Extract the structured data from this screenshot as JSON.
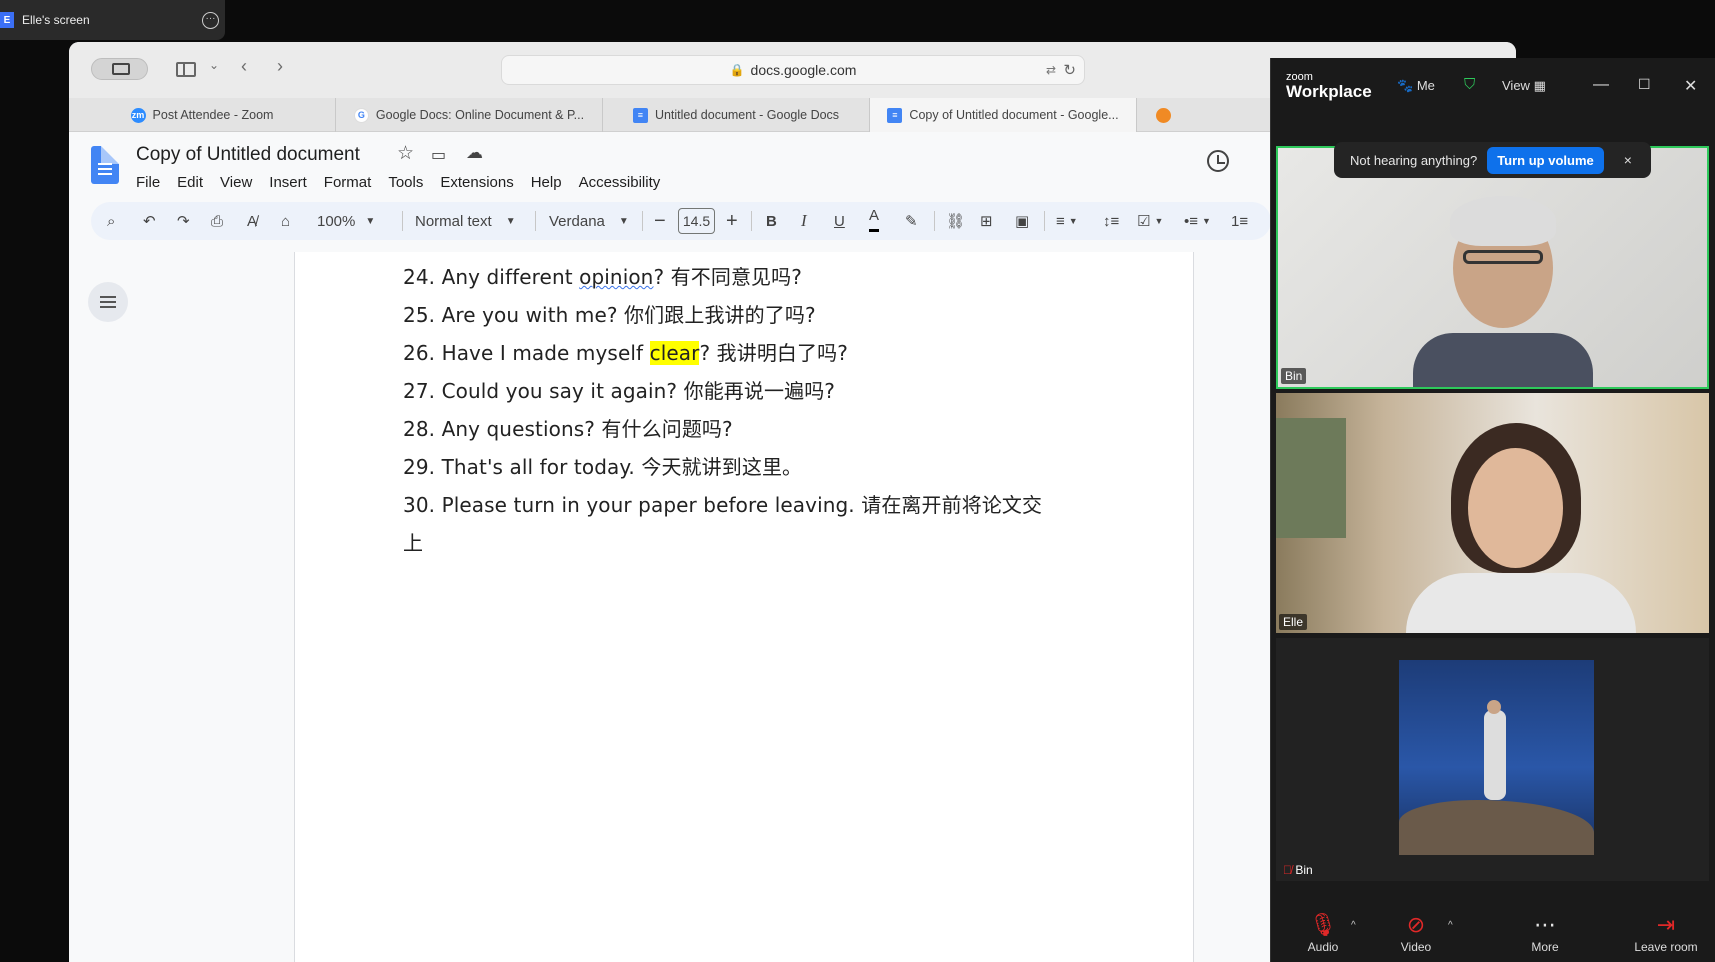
{
  "share_bar": {
    "badge": "E",
    "label": "Elle's screen",
    "more_icon": "more-options-icon"
  },
  "browser": {
    "address": "docs.google.com",
    "tabs": [
      {
        "label": "Post Attendee - Zoom",
        "icon": "zoom-icon"
      },
      {
        "label": "Google Docs: Online Document & P...",
        "icon": "google-icon"
      },
      {
        "label": "Untitled document - Google Docs",
        "icon": "docs-icon"
      },
      {
        "label": "Copy of Untitled document - Google...",
        "icon": "docs-icon",
        "active": true
      }
    ]
  },
  "docs": {
    "title": "Copy of Untitled document",
    "menu": [
      "File",
      "Edit",
      "View",
      "Insert",
      "Format",
      "Tools",
      "Extensions",
      "Help",
      "Accessibility"
    ],
    "toolbar": {
      "zoom": "100%",
      "style": "Normal text",
      "font": "Verdana",
      "font_size": "14.5"
    },
    "lines": [
      {
        "pre": "24. Any different ",
        "squiggle": "opinion",
        "post": "? 有不同意见吗?"
      },
      {
        "pre": "25. Are you with me? 你们跟上我讲的了吗?"
      },
      {
        "pre": "26. Have I made myself ",
        "highlight": "clear",
        "post": "? 我讲明白了吗?"
      },
      {
        "pre": "27. Could you say it again? 你能再说一遍吗?"
      },
      {
        "pre": "28. Any questions? 有什么问题吗?"
      },
      {
        "pre": "29. That's all for today. 今天就讲到这里。"
      },
      {
        "pre": "30. Please turn in your paper before leaving. 请在离开前将论文交"
      },
      {
        "pre": "上"
      }
    ]
  },
  "zoom": {
    "logo_small": "zoom",
    "logo_big": "Workplace",
    "me_label": "Me",
    "view_label": "View",
    "notice": {
      "text": "Not hearing anything?",
      "button": "Turn up volume",
      "close": "×"
    },
    "participants": [
      {
        "name": "Bin",
        "active_speaker": true
      },
      {
        "name": "Elle"
      },
      {
        "name": "Bin",
        "muted": true
      }
    ],
    "controls": {
      "audio": "Audio",
      "video": "Video",
      "more": "More",
      "leave": "Leave room"
    }
  }
}
